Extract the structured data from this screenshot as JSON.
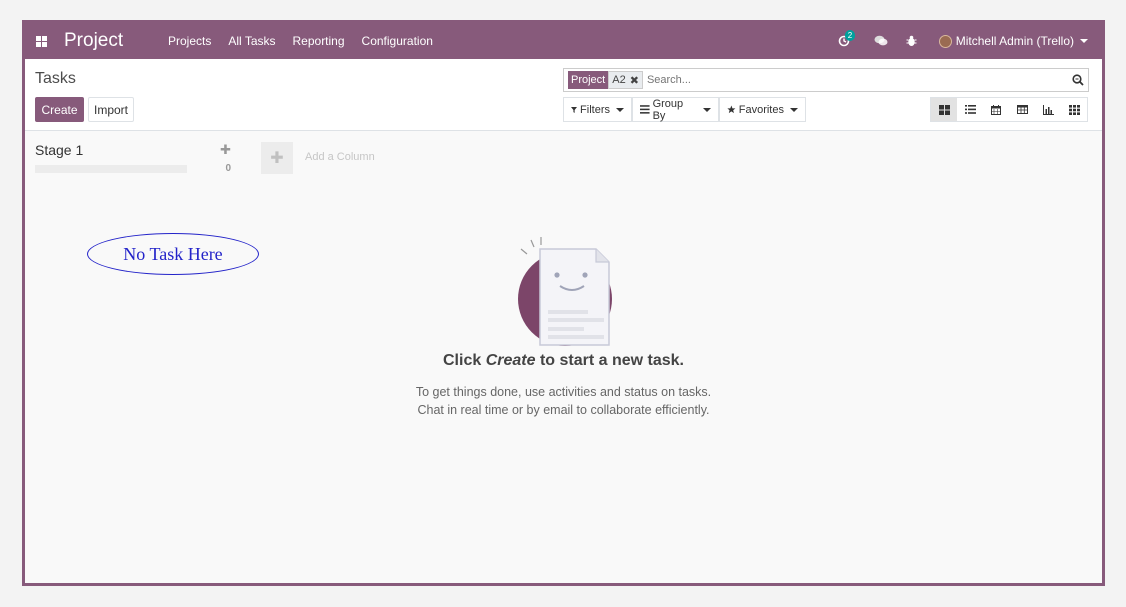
{
  "navbar": {
    "brand": "Project",
    "menu": [
      "Projects",
      "All Tasks",
      "Reporting",
      "Configuration"
    ],
    "activity_count": "2",
    "user": "Mitchell Admin (Trello)"
  },
  "control_panel": {
    "breadcrumb": "Tasks",
    "create_label": "Create",
    "import_label": "Import",
    "search": {
      "facet_label": "Project",
      "facet_value": "A2",
      "placeholder": "Search..."
    },
    "filters_label": "Filters",
    "groupby_label": "Group By",
    "favorites_label": "Favorites"
  },
  "kanban": {
    "column": {
      "title": "Stage 1",
      "count": "0"
    },
    "add_column_label": "Add a Column"
  },
  "annotation": "No Task Here",
  "helper": {
    "title_prefix": "Click ",
    "title_emphasis": "Create",
    "title_suffix": " to start a new task.",
    "line1": "To get things done, use activities and status on tasks.",
    "line2": "Chat in real time or by email to collaborate efficiently."
  },
  "colors": {
    "brand": "#875a7b",
    "accent_badge": "#00a09d",
    "annotation": "#2323c9"
  }
}
